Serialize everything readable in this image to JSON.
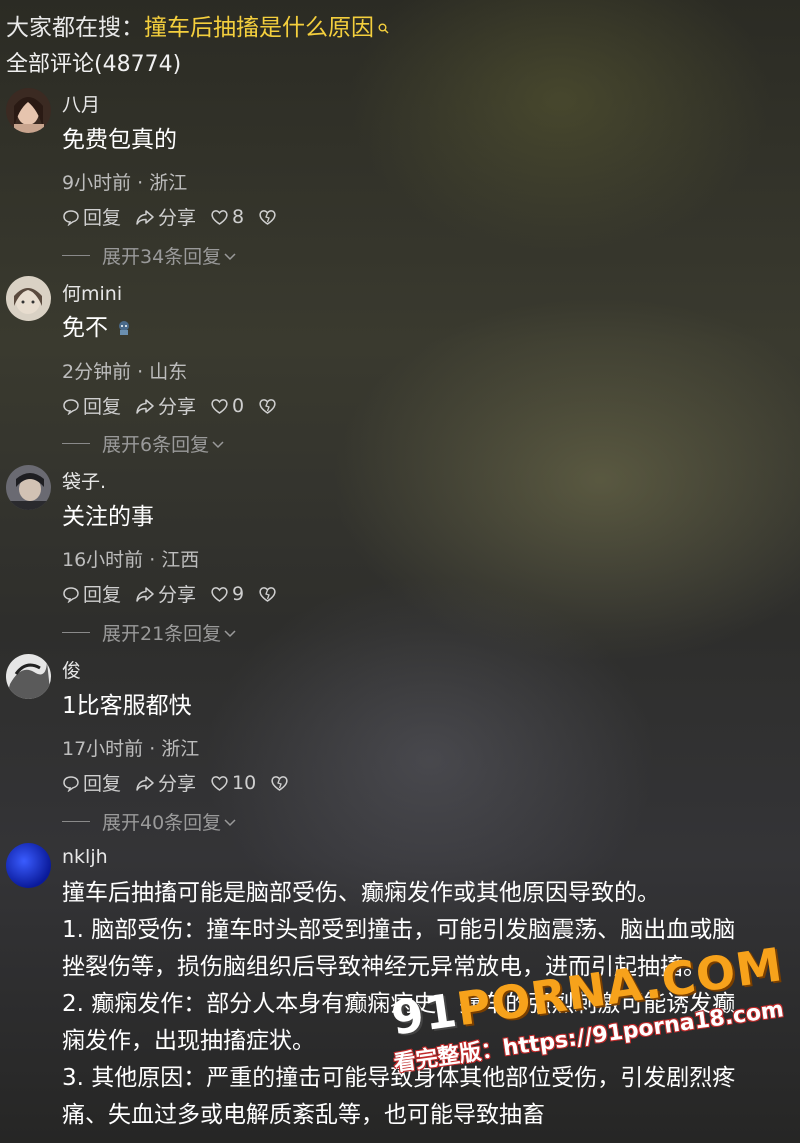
{
  "search_bar": {
    "prefix": "大家都在搜：",
    "keyword": "撞车后抽搐是什么原因",
    "icon": "search-icon"
  },
  "comment_count_label": "全部评论(48774)",
  "comments": [
    {
      "user": "八月",
      "text": "免费包真的",
      "meta": "9小时前 · 浙江",
      "reply": "回复",
      "share": "分享",
      "likes": "8",
      "expand": "展开34条回复"
    },
    {
      "user": "何mini",
      "text": "免不",
      "meta": "2分钟前 · 山东",
      "reply": "回复",
      "share": "分享",
      "likes": "0",
      "expand": "展开6条回复"
    },
    {
      "user": "袋子.",
      "text": "关注的事",
      "meta": "16小时前 · 江西",
      "reply": "回复",
      "share": "分享",
      "likes": "9",
      "expand": "展开21条回复"
    },
    {
      "user": "俊",
      "text": "1比客服都快",
      "meta": "17小时前 · 浙江",
      "reply": "回复",
      "share": "分享",
      "likes": "10",
      "expand": "展开40条回复"
    }
  ],
  "long_comment": {
    "user": "nkljh",
    "lines": [
      "撞车后抽搐可能是脑部受伤、癫痫发作或其他原因导致的。",
      "1. 脑部受伤：撞车时头部受到撞击，可能引发脑震荡、脑出血或脑",
      "挫裂伤等，损伤脑组织后导致神经元异常放电，进而引起抽搐。",
      "2. 癫痫发作：部分人本身有癫痫病史，撞车的强烈刺激可能诱发癫",
      "痫发作，出现抽搐症状。",
      "3. 其他原因：严重的撞击可能导致身体其他部位受伤，引发剧烈疼",
      "痛、失血过多或电解质紊乱等，也可能导致抽畜"
    ]
  },
  "watermark": {
    "logo_prefix": "91",
    "logo_text": "PORNA.COM",
    "url_text": "看完整版：https://91porna18.com"
  },
  "colors": {
    "keyword": "#f4cf3d",
    "text": "#ffffff",
    "meta": "#bdbdbd"
  }
}
